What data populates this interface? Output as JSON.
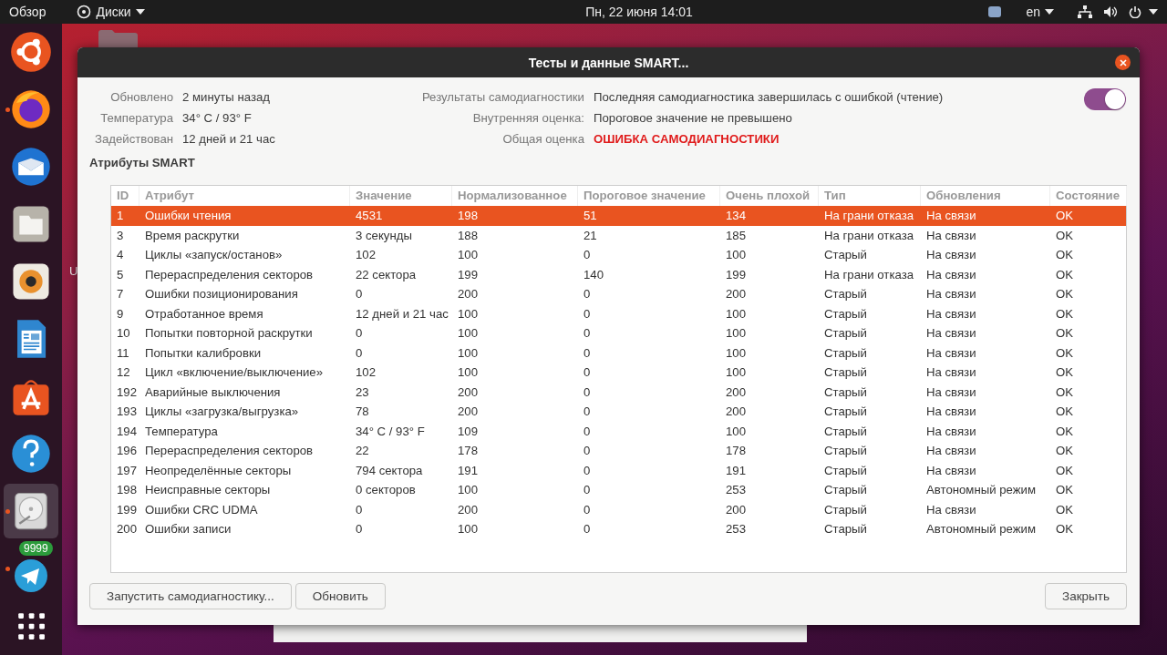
{
  "top_bar": {
    "activities": "Обзор",
    "app_menu": "Диски",
    "clock": "Пн, 22 июня  14:01",
    "keyboard_layout": "en"
  },
  "dock": {
    "items": [
      {
        "kind": "ubuntu",
        "running": false,
        "selected": false
      },
      {
        "kind": "firefox",
        "running": true,
        "selected": false
      },
      {
        "kind": "mail",
        "running": false,
        "selected": false
      },
      {
        "kind": "files",
        "running": false,
        "selected": false
      },
      {
        "kind": "speaker",
        "running": false,
        "selected": false
      },
      {
        "kind": "writer",
        "running": false,
        "selected": false
      },
      {
        "kind": "store",
        "running": false,
        "selected": false
      },
      {
        "kind": "help",
        "running": false,
        "selected": false
      },
      {
        "kind": "disks",
        "running": true,
        "selected": true
      },
      {
        "kind": "telegram",
        "running": true,
        "selected": false,
        "badge": "9999"
      },
      {
        "kind": "grid",
        "running": false,
        "selected": false
      }
    ]
  },
  "desktop": {
    "label_fragment": "U"
  },
  "dialog": {
    "title": "Тесты и данные SMART...",
    "info_left": [
      {
        "label": "Обновлено",
        "value": "2 минуты назад"
      },
      {
        "label": "Температура",
        "value": "34° C / 93° F"
      },
      {
        "label": "Задействован",
        "value": "12 дней и 21 час"
      }
    ],
    "info_right": [
      {
        "label": "Результаты самодиагностики",
        "value": "Последняя самодиагностика завершилась с ошибкой (чтение)",
        "kind": "normal"
      },
      {
        "label": "Внутренняя оценка:",
        "value": "Пороговое значение не превышено",
        "kind": "normal"
      },
      {
        "label": "Общая оценка",
        "value": "ОШИБКА САМОДИАГНОСТИКИ",
        "kind": "error"
      }
    ],
    "smart_toggle": {
      "on": true
    },
    "section_title": "Атрибуты SMART",
    "table": {
      "columns": [
        "ID",
        "Атрибут",
        "Значение",
        "Нормализованное",
        "Пороговое значение",
        "Очень плохой",
        "Тип",
        "Обновления",
        "Состояние"
      ],
      "rows": [
        {
          "cells": [
            "1",
            "Ошибки чтения",
            "4531",
            "198",
            "51",
            "134",
            "На грани отказа",
            "На связи",
            "OK"
          ],
          "selected": true
        },
        {
          "cells": [
            "3",
            "Время раскрутки",
            "3 секунды",
            "188",
            "21",
            "185",
            "На грани отказа",
            "На связи",
            "OK"
          ],
          "selected": false
        },
        {
          "cells": [
            "4",
            "Циклы «запуск/останов»",
            "102",
            "100",
            "0",
            "100",
            "Старый",
            "На связи",
            "OK"
          ],
          "selected": false
        },
        {
          "cells": [
            "5",
            "Перераспределения секторов",
            "22 сектора",
            "199",
            "140",
            "199",
            "На грани отказа",
            "На связи",
            "OK"
          ],
          "selected": false
        },
        {
          "cells": [
            "7",
            "Ошибки позиционирования",
            "0",
            "200",
            "0",
            "200",
            "Старый",
            "На связи",
            "OK"
          ],
          "selected": false
        },
        {
          "cells": [
            "9",
            "Отработанное время",
            "12 дней и 21 час",
            "100",
            "0",
            "100",
            "Старый",
            "На связи",
            "OK"
          ],
          "selected": false
        },
        {
          "cells": [
            "10",
            "Попытки повторной раскрутки",
            "0",
            "100",
            "0",
            "100",
            "Старый",
            "На связи",
            "OK"
          ],
          "selected": false
        },
        {
          "cells": [
            "11",
            "Попытки калибровки",
            "0",
            "100",
            "0",
            "100",
            "Старый",
            "На связи",
            "OK"
          ],
          "selected": false
        },
        {
          "cells": [
            "12",
            "Цикл «включение/выключение»",
            "102",
            "100",
            "0",
            "100",
            "Старый",
            "На связи",
            "OK"
          ],
          "selected": false
        },
        {
          "cells": [
            "192",
            "Аварийные выключения",
            "23",
            "200",
            "0",
            "200",
            "Старый",
            "На связи",
            "OK"
          ],
          "selected": false
        },
        {
          "cells": [
            "193",
            "Циклы «загрузка/выгрузка»",
            "78",
            "200",
            "0",
            "200",
            "Старый",
            "На связи",
            "OK"
          ],
          "selected": false
        },
        {
          "cells": [
            "194",
            "Температура",
            "34° C / 93° F",
            "109",
            "0",
            "100",
            "Старый",
            "На связи",
            "OK"
          ],
          "selected": false
        },
        {
          "cells": [
            "196",
            "Перераспределения секторов",
            "22",
            "178",
            "0",
            "178",
            "Старый",
            "На связи",
            "OK"
          ],
          "selected": false
        },
        {
          "cells": [
            "197",
            "Неопределённые секторы",
            "794 сектора",
            "191",
            "0",
            "191",
            "Старый",
            "На связи",
            "OK"
          ],
          "selected": false
        },
        {
          "cells": [
            "198",
            "Неисправные секторы",
            "0 секторов",
            "100",
            "0",
            "253",
            "Старый",
            "Автономный режим",
            "OK"
          ],
          "selected": false
        },
        {
          "cells": [
            "199",
            "Ошибки CRC UDMA",
            "0",
            "200",
            "0",
            "200",
            "Старый",
            "На связи",
            "OK"
          ],
          "selected": false
        },
        {
          "cells": [
            "200",
            "Ошибки записи",
            "0",
            "100",
            "0",
            "253",
            "Старый",
            "Автономный режим",
            "OK"
          ],
          "selected": false
        }
      ]
    },
    "buttons_left": [
      "Запустить самодиагностику...",
      "Обновить"
    ],
    "button_right": "Закрыть"
  }
}
